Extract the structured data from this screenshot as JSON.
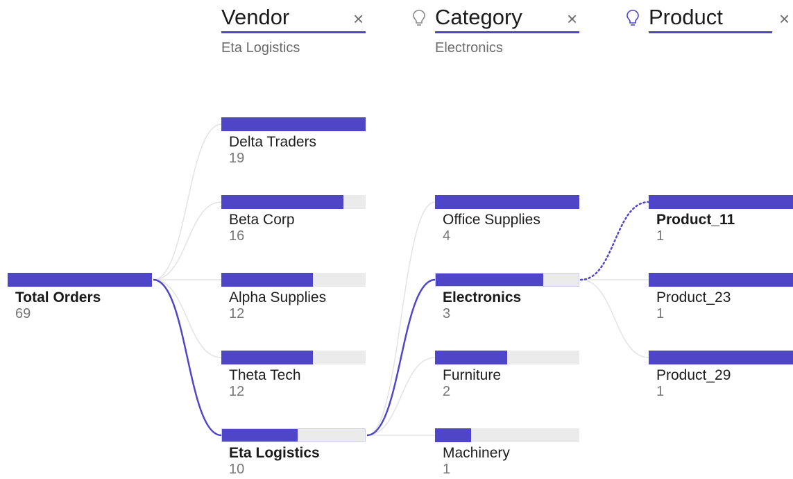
{
  "headers": {
    "vendor": {
      "title": "Vendor",
      "filter": "Eta Logistics",
      "close": "×"
    },
    "category": {
      "title": "Category",
      "filter": "Electronics",
      "close": "×"
    },
    "product": {
      "title": "Product",
      "filter": "",
      "close": "×"
    }
  },
  "root": {
    "label": "Total Orders",
    "value": "69",
    "fraction": 1.0
  },
  "vendors": [
    {
      "label": "Delta Traders",
      "value": "19",
      "fraction": 1.0
    },
    {
      "label": "Beta Corp",
      "value": "16",
      "fraction": 0.842
    },
    {
      "label": "Alpha Supplies",
      "value": "12",
      "fraction": 0.632
    },
    {
      "label": "Theta Tech",
      "value": "12",
      "fraction": 0.632
    },
    {
      "label": "Eta Logistics",
      "value": "10",
      "fraction": 0.526
    }
  ],
  "categories": [
    {
      "label": "Office Supplies",
      "value": "4",
      "fraction": 1.0
    },
    {
      "label": "Electronics",
      "value": "3",
      "fraction": 0.75
    },
    {
      "label": "Furniture",
      "value": "2",
      "fraction": 0.5
    },
    {
      "label": "Machinery",
      "value": "1",
      "fraction": 0.25
    }
  ],
  "products": [
    {
      "label": "Product_11",
      "value": "1",
      "fraction": 1.0
    },
    {
      "label": "Product_23",
      "value": "1",
      "fraction": 1.0
    },
    {
      "label": "Product_29",
      "value": "1",
      "fraction": 1.0
    }
  ],
  "colors": {
    "accent": "#4f45c9",
    "track": "#ebebeb",
    "link_inactive": "#e3e3e3"
  },
  "icons": {
    "close": "close-icon",
    "suggest": "lightbulb-icon"
  }
}
